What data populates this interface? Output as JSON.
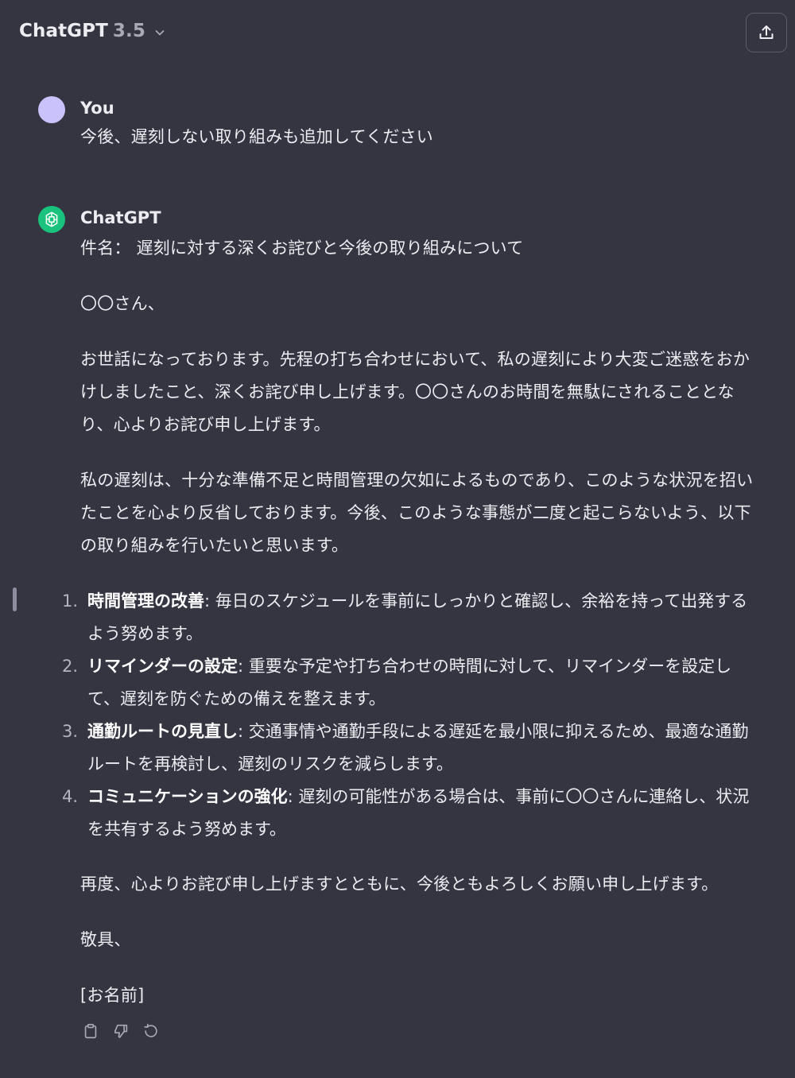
{
  "header": {
    "model_name": "ChatGPT",
    "model_version": "3.5",
    "chevron_icon": "chevron-down-icon",
    "share_icon": "share-icon"
  },
  "colors": {
    "background": "#343541",
    "text": "#ececf1",
    "muted": "#a8a9b3",
    "user_avatar": "#c9c2fb",
    "assistant_avatar": "#19c37d"
  },
  "user_message": {
    "author": "You",
    "text": "今後、遅刻しない取り組みも追加してください"
  },
  "assistant_message": {
    "author": "ChatGPT",
    "subject": "件名： 遅刻に対する深くお詫びと今後の取り組みについて",
    "greeting": "〇〇さん、",
    "para1": "お世話になっております。先程の打ち合わせにおいて、私の遅刻により大変ご迷惑をおかけしましたこと、深くお詫び申し上げます。〇〇さんのお時間を無駄にされることとなり、心よりお詫び申し上げます。",
    "para2": "私の遅刻は、十分な準備不足と時間管理の欠如によるものであり、このような状況を招いたことを心より反省しております。今後、このような事態が二度と起こらないよう、以下の取り組みを行いたいと思います。",
    "list": [
      {
        "num": "1.",
        "title": "時間管理の改善",
        "text": ": 毎日のスケジュールを事前にしっかりと確認し、余裕を持って出発するよう努めます。"
      },
      {
        "num": "2.",
        "title": "リマインダーの設定",
        "text": ": 重要な予定や打ち合わせの時間に対して、リマインダーを設定して、遅刻を防ぐための備えを整えます。"
      },
      {
        "num": "3.",
        "title": "通勤ルートの見直し",
        "text": ": 交通事情や通勤手段による遅延を最小限に抑えるため、最適な通勤ルートを再検討し、遅刻のリスクを減らします。"
      },
      {
        "num": "4.",
        "title": "コミュニケーションの強化",
        "text": ": 遅刻の可能性がある場合は、事前に〇〇さんに連絡し、状況を共有するよう努めます。"
      }
    ],
    "closing": "再度、心よりお詫び申し上げますとともに、今後ともよろしくお願い申し上げます。",
    "sign_off": "敬具、",
    "signature": "[お名前]"
  },
  "actions": {
    "copy_icon": "clipboard-icon",
    "dislike_icon": "thumbs-down-icon",
    "regenerate_icon": "regenerate-icon"
  }
}
